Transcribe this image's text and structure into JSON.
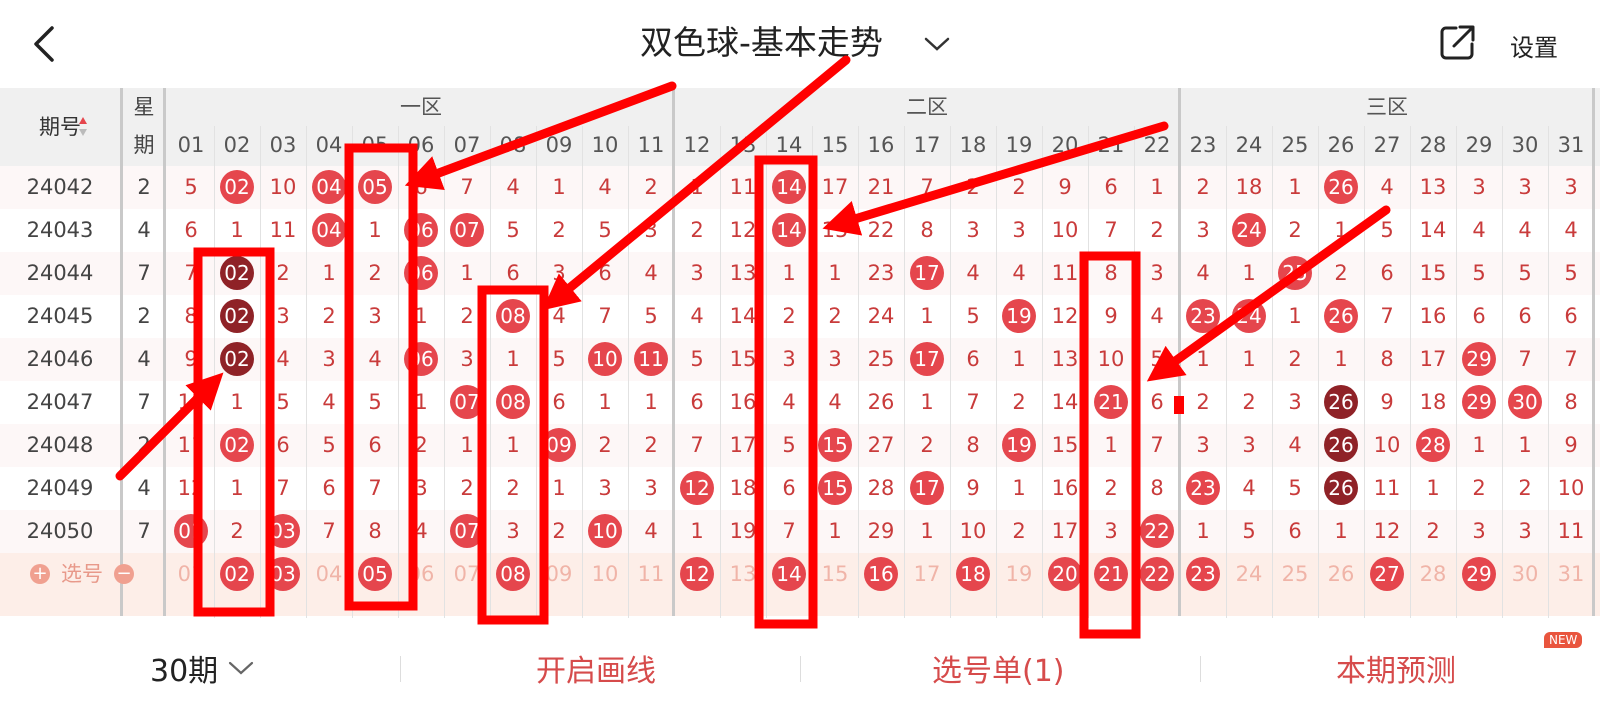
{
  "header": {
    "title": "双色球-基本走势",
    "settings_label": "设置"
  },
  "zones": [
    "一区",
    "二区",
    "三区"
  ],
  "period_header": "期号",
  "week_header": [
    "星",
    "期"
  ],
  "number_columns": [
    "01",
    "02",
    "03",
    "04",
    "05",
    "06",
    "07",
    "08",
    "09",
    "10",
    "11",
    "12",
    "13",
    "14",
    "15",
    "16",
    "17",
    "18",
    "19",
    "20",
    "21",
    "22",
    "23",
    "24",
    "25",
    "26",
    "27",
    "28",
    "29",
    "30",
    "31"
  ],
  "rows": [
    {
      "period": "24042",
      "weekday": "2",
      "cells": [
        "5",
        "02",
        "10",
        "04",
        "05",
        "6",
        "7",
        "4",
        "1",
        "4",
        "2",
        "1",
        "11",
        "14",
        "17",
        "21",
        "7",
        "2",
        "2",
        "9",
        "6",
        "1",
        "2",
        "18",
        "1",
        "26",
        "4",
        "13",
        "3",
        "3",
        "3"
      ],
      "hits": [
        "02",
        "04",
        "05",
        "14",
        "26"
      ],
      "dark": []
    },
    {
      "period": "24043",
      "weekday": "4",
      "cells": [
        "6",
        "1",
        "11",
        "04",
        "1",
        "06",
        "07",
        "5",
        "2",
        "5",
        "3",
        "2",
        "12",
        "14",
        "15",
        "22",
        "8",
        "3",
        "3",
        "10",
        "7",
        "2",
        "3",
        "24",
        "2",
        "1",
        "5",
        "14",
        "4",
        "4",
        "4"
      ],
      "hits": [
        "04",
        "06",
        "07",
        "14",
        "24"
      ],
      "dark": []
    },
    {
      "period": "24044",
      "weekday": "7",
      "cells": [
        "7",
        "02",
        "2",
        "1",
        "2",
        "06",
        "1",
        "6",
        "3",
        "6",
        "4",
        "3",
        "13",
        "1",
        "1",
        "23",
        "17",
        "4",
        "4",
        "11",
        "8",
        "3",
        "4",
        "1",
        "25",
        "2",
        "6",
        "15",
        "5",
        "5",
        "5"
      ],
      "hits": [
        "06",
        "17",
        "25"
      ],
      "dark": [
        "02"
      ]
    },
    {
      "period": "24045",
      "weekday": "2",
      "cells": [
        "8",
        "02",
        "3",
        "2",
        "3",
        "1",
        "2",
        "08",
        "4",
        "7",
        "5",
        "4",
        "14",
        "2",
        "2",
        "24",
        "1",
        "5",
        "19",
        "12",
        "9",
        "4",
        "23",
        "24",
        "1",
        "26",
        "7",
        "16",
        "6",
        "6",
        "6"
      ],
      "hits": [
        "08",
        "19",
        "23",
        "24",
        "26"
      ],
      "dark": [
        "02"
      ]
    },
    {
      "period": "24046",
      "weekday": "4",
      "cells": [
        "9",
        "02",
        "4",
        "3",
        "4",
        "06",
        "3",
        "1",
        "5",
        "10",
        "11",
        "5",
        "15",
        "3",
        "3",
        "25",
        "17",
        "6",
        "1",
        "13",
        "10",
        "5",
        "1",
        "1",
        "2",
        "1",
        "8",
        "17",
        "29",
        "7",
        "7"
      ],
      "hits": [
        "06",
        "10",
        "11",
        "17",
        "29"
      ],
      "dark": [
        "02"
      ]
    },
    {
      "period": "24047",
      "weekday": "7",
      "cells": [
        "10",
        "1",
        "5",
        "4",
        "5",
        "1",
        "07",
        "08",
        "6",
        "1",
        "1",
        "6",
        "16",
        "4",
        "4",
        "26",
        "1",
        "7",
        "2",
        "14",
        "21",
        "6",
        "2",
        "2",
        "3",
        "26",
        "9",
        "18",
        "29",
        "30",
        "8"
      ],
      "hits": [
        "07",
        "08",
        "21",
        "29",
        "30"
      ],
      "dark": [
        "26"
      ]
    },
    {
      "period": "24048",
      "weekday": "2",
      "cells": [
        "11",
        "02",
        "6",
        "5",
        "6",
        "2",
        "1",
        "1",
        "09",
        "2",
        "2",
        "7",
        "17",
        "5",
        "15",
        "27",
        "2",
        "8",
        "19",
        "15",
        "1",
        "7",
        "3",
        "3",
        "4",
        "26",
        "10",
        "28",
        "1",
        "1",
        "9"
      ],
      "hits": [
        "02",
        "09",
        "15",
        "19",
        "28"
      ],
      "dark": [
        "26"
      ]
    },
    {
      "period": "24049",
      "weekday": "4",
      "cells": [
        "12",
        "1",
        "7",
        "6",
        "7",
        "3",
        "2",
        "2",
        "1",
        "3",
        "3",
        "12",
        "18",
        "6",
        "15",
        "28",
        "17",
        "9",
        "1",
        "16",
        "2",
        "8",
        "23",
        "4",
        "5",
        "26",
        "11",
        "1",
        "2",
        "2",
        "10"
      ],
      "hits": [
        "12",
        "15",
        "17",
        "23"
      ],
      "dark": [
        "26"
      ]
    },
    {
      "period": "24050",
      "weekday": "7",
      "cells": [
        "01",
        "2",
        "03",
        "7",
        "8",
        "4",
        "07",
        "3",
        "2",
        "10",
        "4",
        "1",
        "19",
        "7",
        "1",
        "29",
        "1",
        "10",
        "2",
        "17",
        "3",
        "22",
        "1",
        "5",
        "6",
        "1",
        "12",
        "2",
        "3",
        "3",
        "11"
      ],
      "hits": [
        "01",
        "03",
        "07",
        "10",
        "22"
      ],
      "dark": []
    }
  ],
  "selection_row": {
    "label": "选号",
    "plus_icon": "plus-circle-icon",
    "minus_icon": "minus-circle-icon",
    "selected": [
      "02",
      "03",
      "05",
      "08",
      "12",
      "14",
      "16",
      "18",
      "20",
      "21",
      "22",
      "23",
      "27",
      "29"
    ]
  },
  "bottom": {
    "periods_label": "30期",
    "draw_lines_label": "开启画线",
    "selection_list_label": "选号单(1)",
    "prediction_label": "本期预测",
    "new_badge": "NEW"
  },
  "colors": {
    "accent_red": "#e5464d",
    "dark_red": "#8f2227",
    "number_text": "#c93b3b",
    "annotation_red": "#ff0000"
  }
}
